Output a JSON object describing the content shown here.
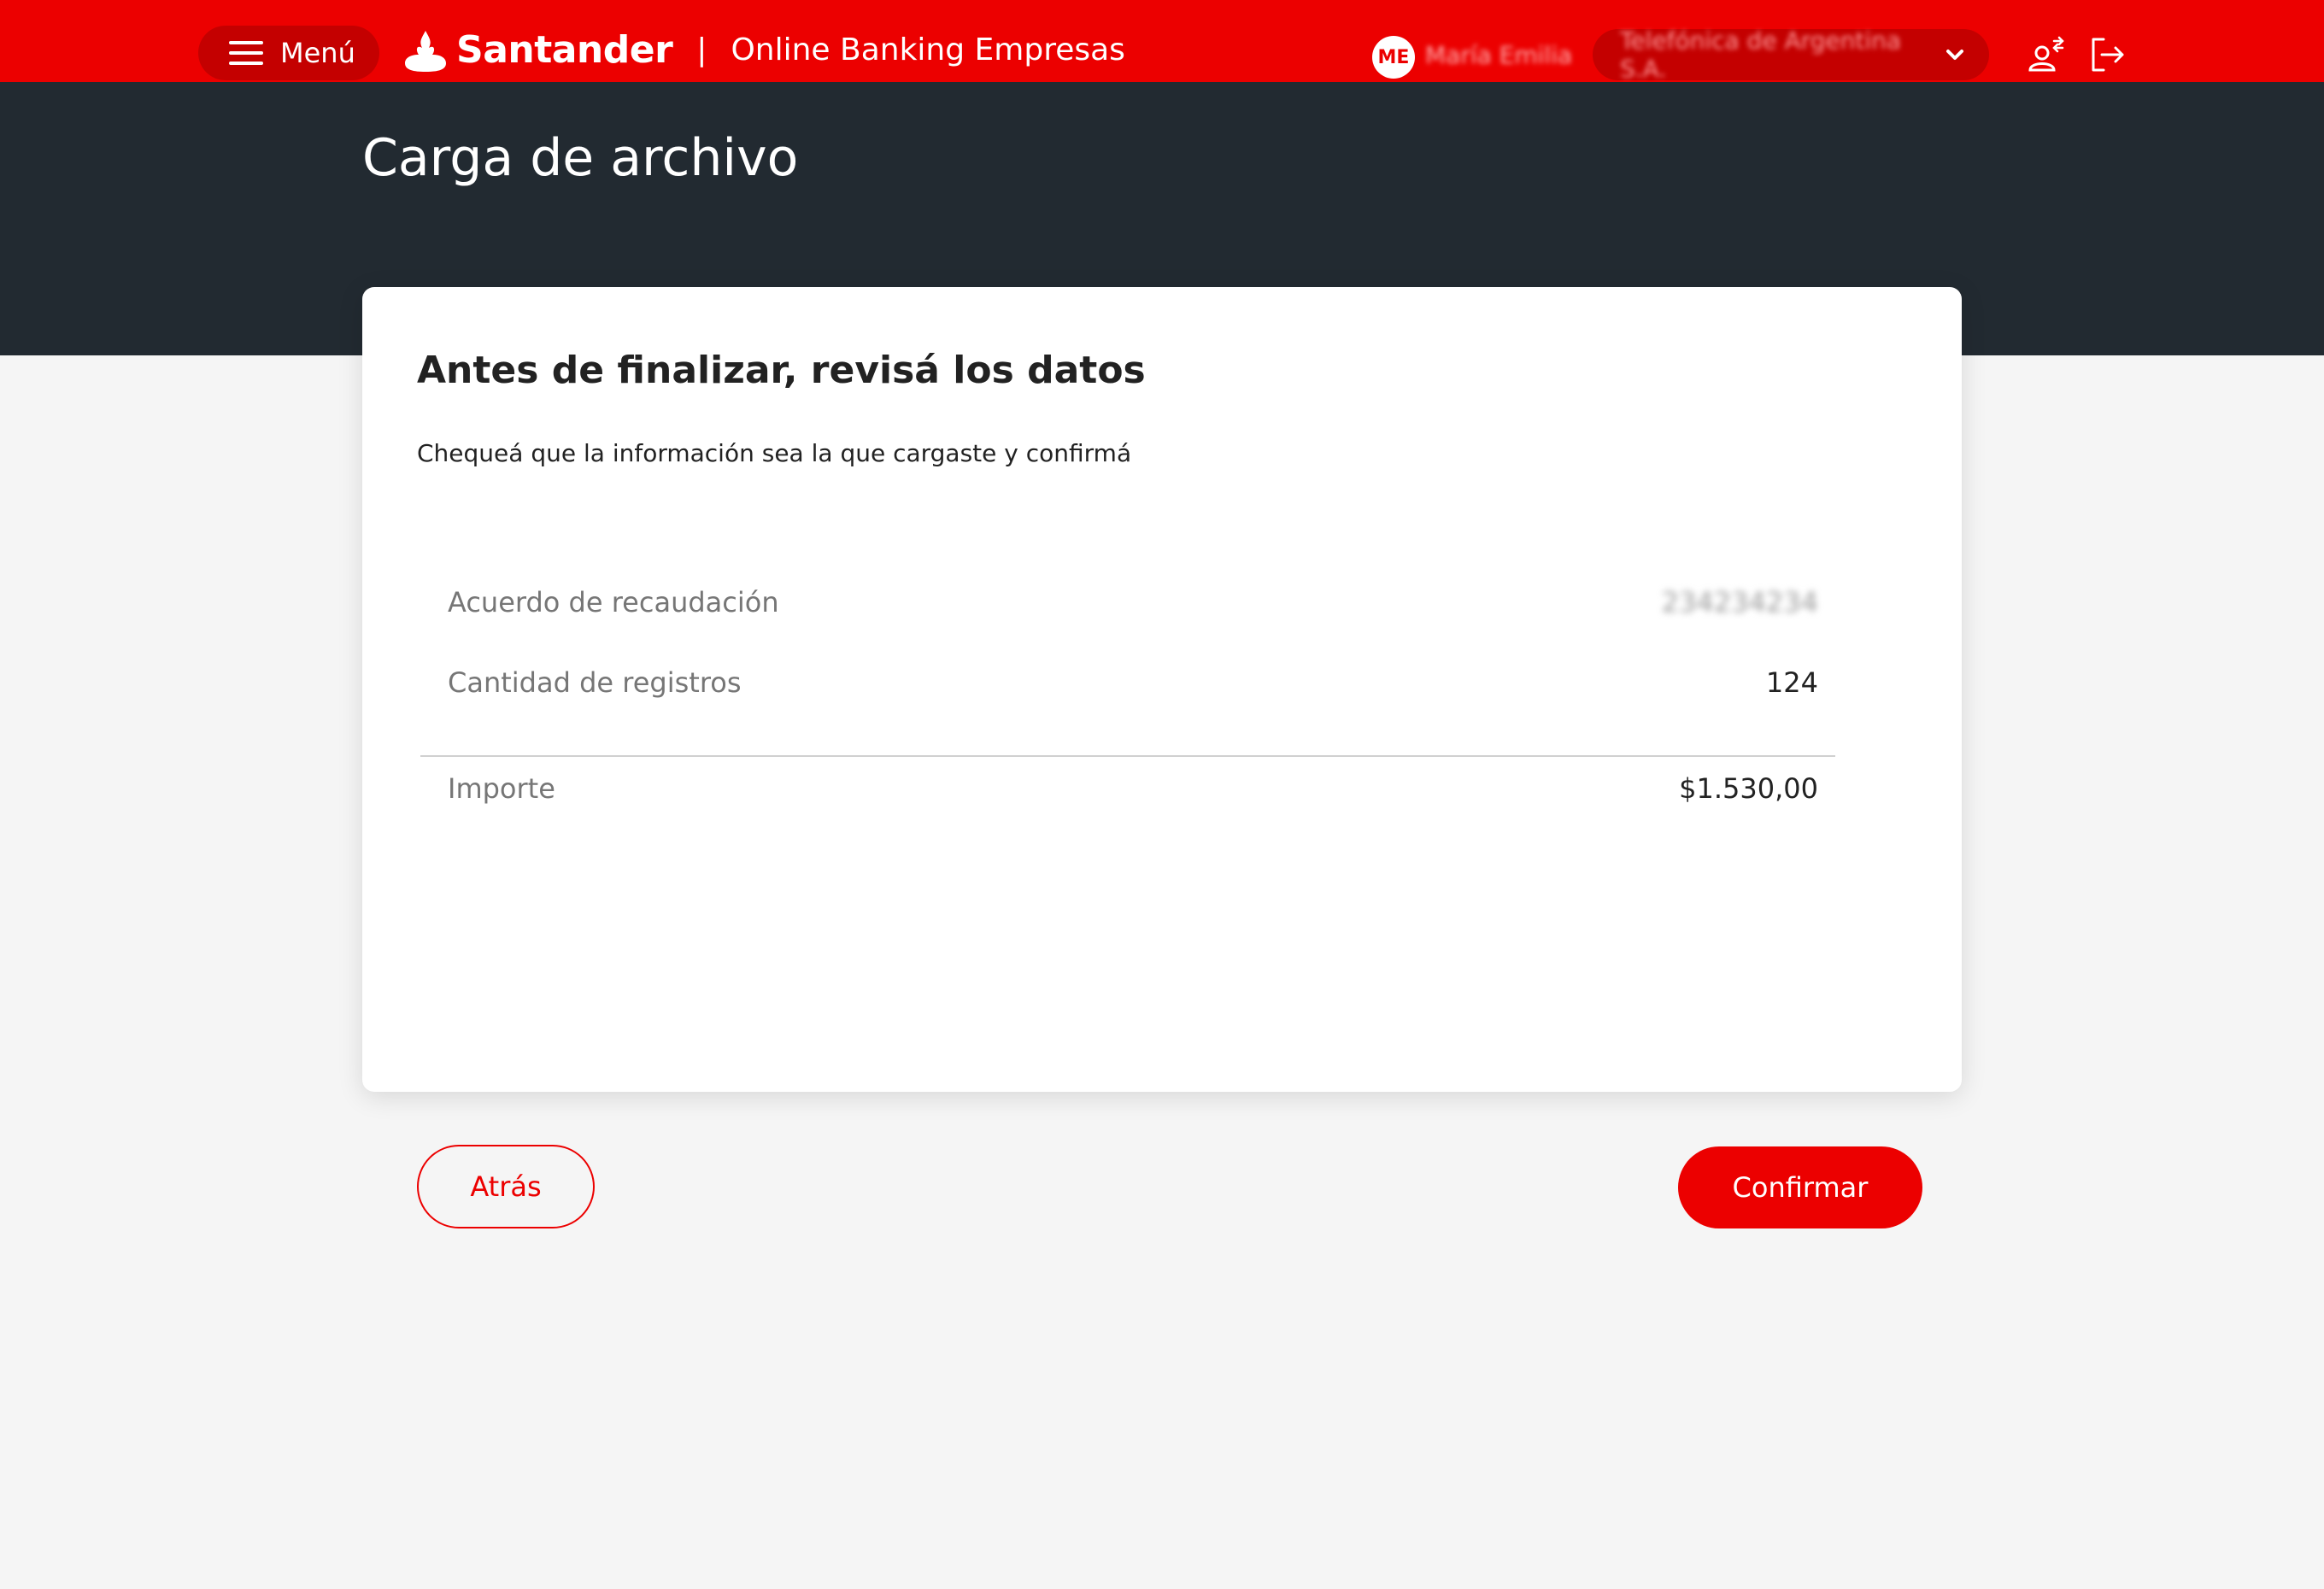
{
  "header": {
    "menu_label": "Menú",
    "brand_name": "Santander",
    "brand_separator": "|",
    "brand_subtitle": "Online Banking Empresas",
    "user_initials": "ME",
    "user_name": "María Emilia",
    "company_name": "Telefónica de Argentina S.A.",
    "brand_color": "#ec0000",
    "icons": [
      "menu-icon",
      "santander-flame-icon",
      "chevron-down-icon",
      "switch-user-icon",
      "logout-icon"
    ]
  },
  "page": {
    "title": "Carga de archivo"
  },
  "card": {
    "title": "Antes de finalizar, revisá los datos",
    "subtitle": "Chequeá que la información sea la que cargaste y confirmá",
    "rows": [
      {
        "label": "Acuerdo de recaudación",
        "value": "234234234"
      },
      {
        "label": "Cantidad de registros",
        "value": "124"
      }
    ],
    "total": {
      "label": "Importe",
      "value": "$1.530,00"
    }
  },
  "actions": {
    "back_label": "Atrás",
    "confirm_label": "Confirmar"
  }
}
